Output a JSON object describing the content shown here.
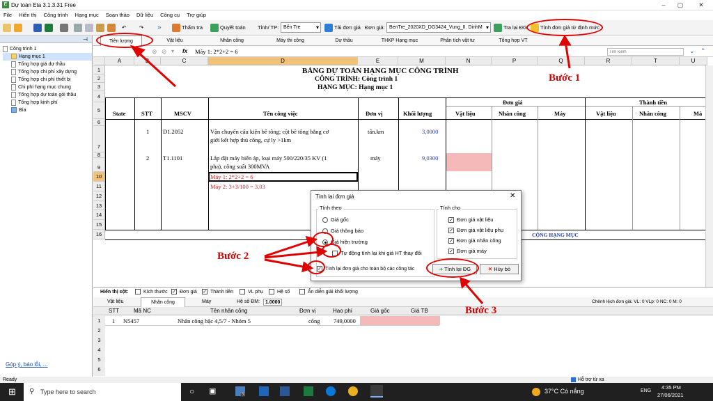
{
  "window": {
    "title": "Dự toán Eta 3.1.3.31 Free"
  },
  "menu": [
    "File",
    "Hiển thị",
    "Công trình",
    "Hạng mục",
    "Soạn thảo",
    "Dữ liệu",
    "Công cụ",
    "Trợ giúp"
  ],
  "toolbar": {
    "tham_tra": "Thẩm tra",
    "quyet_toan": "Quyết toán",
    "province_label": "Tỉnh/ TP:",
    "province": "Bến Tre",
    "tai_don_gia": "Tải đơn giá",
    "don_gia_label": "Đơn giá:",
    "don_gia": "BenTre_2020XD_DG3424_Vung_II. DinhM",
    "tra_lai_dg": "Tra lại ĐG",
    "tinh_don_gia": "Tính đơn giá từ định mức"
  },
  "sidebar": {
    "items": [
      "Công trình 1",
      "Hạng mục 1",
      "Tổng hợp giá dự thầu",
      "Tổng hợp chi phí xây dựng",
      "Tổng hợp chi phí thiết bị",
      "Chi phí hạng mục chung",
      "Tổng hợp dự toán gói thầu",
      "Tổng hợp kinh phí",
      "Bìa"
    ],
    "feedback": "Góp ý, báo lỗi, ..."
  },
  "tabs": [
    "Tiên lượng",
    "Vật liệu",
    "Nhân công",
    "Máy thi công",
    "Dự thầu",
    "THKP Hạng mục",
    "Phân tích vật tư",
    "Tổng hợp VT"
  ],
  "formula": {
    "fx": "fx",
    "value": "Máy 1: 2*2+2 = 6",
    "search_placeholder": "Tìm kiếm"
  },
  "grid": {
    "columns": [
      "A",
      "B",
      "C",
      "D",
      "E",
      "M",
      "N",
      "P",
      "Q",
      "R",
      "T",
      "U"
    ],
    "rows": [
      "1",
      "2",
      "3",
      "4",
      "5",
      "6",
      "7",
      "8",
      "9",
      "10",
      "11",
      "12",
      "13",
      "14",
      "15",
      "16"
    ],
    "title": "BẢNG DỰ TOÁN HẠNG MỤC CÔNG TRÌNH",
    "subtitle1": "CÔNG TRÌNH: Công trình 1",
    "subtitle2": "HẠNG MỤC: Hạng mục 1",
    "h_don_gia": "Đơn giá",
    "h_thanh_tien": "Thành tiền",
    "h_state": "State",
    "h_stt": "STT",
    "h_mscv": "MSCV",
    "h_ten": "Tên công việc",
    "h_dvi": "Đơn vị",
    "h_kl": "Khối lượng",
    "h_vl": "Vật liệu",
    "h_nc": "Nhân công",
    "h_may": "Máy",
    "h_vl2": "Vật liệu",
    "h_nc2": "Nhân công",
    "h_ma": "Má",
    "r7": {
      "stt": "1",
      "mscv": "D1.2052",
      "ten1": "Vận chuyển cấu kiện bê tông; cột bê tông bằng cơ",
      "ten2": "giới kết hợp thủ công, cự ly >1km",
      "dvi": "tấn.km",
      "kl": "3,0000"
    },
    "r9": {
      "stt": "2",
      "mscv": "T1.1101",
      "ten1": "Lắp đặt máy biến áp, loại máy 500/220/35 KV (1",
      "ten2": "pha), công suất 300MVA",
      "dvi": "máy",
      "kl": "9,0300"
    },
    "r10": "Máy 1: 2*2+2 = 6",
    "r11": "Máy 2: 3+3/100 = 3,03",
    "cong": "CỘNG HẠNG MỤC"
  },
  "display_bar": {
    "label": "Hiển thị cột:",
    "items": [
      "Kích thước",
      "Đơn giá",
      "Thành tiền",
      "VL phụ",
      "Hệ số",
      "Ẩn diễn giải khối lượng"
    ]
  },
  "bottom": {
    "tabs": [
      "Vật liệu",
      "Nhân công",
      "Máy"
    ],
    "he_so_label": "Hệ số ĐM:",
    "he_so": "1.0000",
    "chenh_lech": "Chênh lệch đơn giá: VL: 0   VLp: 0   NC: 0   M: 0",
    "headers": [
      "STT",
      "Mã NC",
      "Tên nhân công",
      "Đơn vị",
      "Hao phí",
      "Giá gốc",
      "Giá TB"
    ],
    "row": [
      "1",
      "N5457",
      "Nhân công bậc 4,5/7 - Nhóm 5",
      "công",
      "749,0000"
    ],
    "rows": [
      "1",
      "2",
      "3",
      "4",
      "5",
      "6"
    ]
  },
  "status": {
    "ready": "Ready",
    "help": "Hỗ trợ từ xa"
  },
  "dialog": {
    "title": "Tính lại đơn giá",
    "tinh_theo": "Tính theo",
    "gia_goc": "Giá gốc",
    "gia_thong_bao": "Giá thông báo",
    "gia_hien_truong": "Giá hiện trường",
    "tu_dong": "Tự động tính lại khi giá HT thay đổi",
    "tinh_cho": "Tính cho",
    "dg_vl": "Đơn giá vật liệu",
    "dg_vlp": "Đơn giá vật liệu phụ",
    "dg_nc": "Đơn giá nhân công",
    "dg_may": "Đơn giá máy",
    "toan_bo": "Tính lại đơn giá cho toàn bộ các công tác",
    "ok": "Tính lại ĐG",
    "cancel": "Hủy bỏ"
  },
  "annotations": {
    "b1": "Bước 1",
    "b2": "Bước 2",
    "b3": "Bước 3"
  },
  "taskbar": {
    "search": "Type here to search",
    "weather": "37°C  Có nắng",
    "lang": "ENG",
    "time": "4:35 PM",
    "date": "27/06/2021",
    "badge": "5"
  },
  "colors": {
    "accent_red": "#e00000",
    "pink_cell": "#f5b9b9",
    "blue_text": "#1f3fbf"
  }
}
